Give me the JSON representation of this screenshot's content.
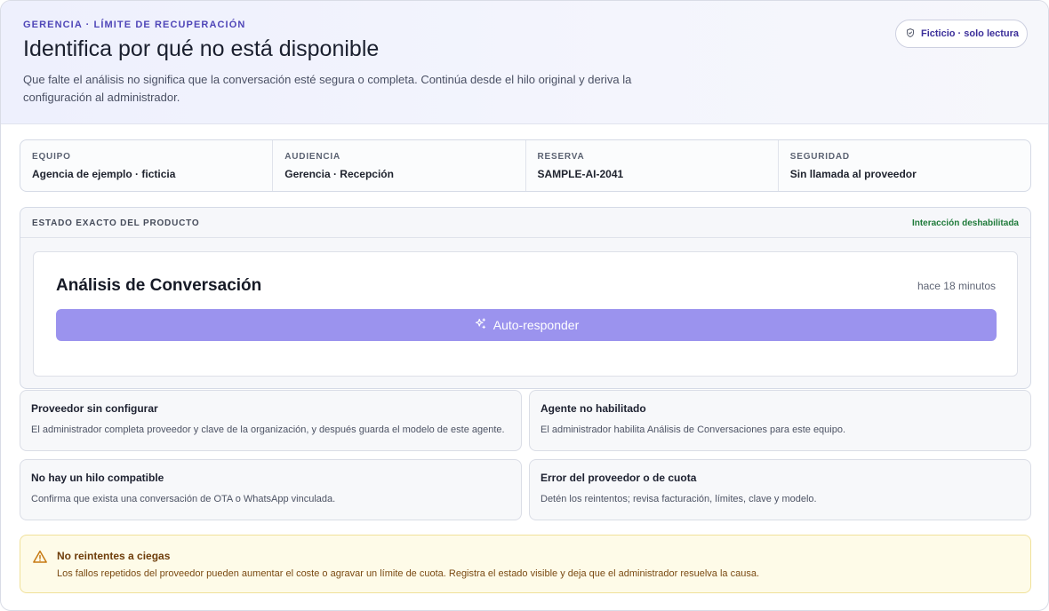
{
  "header": {
    "eyebrow": "GERENCIA · LÍMITE DE RECUPERACIÓN",
    "title": "Identifica por qué no está disponible",
    "description": "Que falte el análisis no significa que la conversación esté segura o completa. Continúa desde el hilo original y deriva la configuración al administrador.",
    "badge": {
      "icon": "shield-check-icon",
      "label": "Ficticio · solo lectura"
    }
  },
  "meta": [
    {
      "label": "EQUIPO",
      "value": "Agencia de ejemplo · ficticia"
    },
    {
      "label": "AUDIENCIA",
      "value": "Gerencia · Recepción"
    },
    {
      "label": "RESERVA",
      "value": "SAMPLE-AI-2041"
    },
    {
      "label": "SEGURIDAD",
      "value": "Sin llamada al proveedor"
    }
  ],
  "state": {
    "label": "ESTADO EXACTO DEL PRODUCTO",
    "status": "Interacción deshabilitada",
    "status_color": "#1f7a3a",
    "card": {
      "title": "Análisis de Conversación",
      "time": "hace 18 minutos",
      "button_icon": "sparkles-icon",
      "button_label": "Auto-responder",
      "button_color": "#9b93ee"
    }
  },
  "reasons": [
    {
      "title": "Proveedor sin configurar",
      "text": "El administrador completa proveedor y clave de la organización, y después guarda el modelo de este agente."
    },
    {
      "title": "Agente no habilitado",
      "text": "El administrador habilita Análisis de Conversaciones para este equipo."
    },
    {
      "title": "No hay un hilo compatible",
      "text": "Confirma que exista una conversación de OTA o WhatsApp vinculada."
    },
    {
      "title": "Error del proveedor o de cuota",
      "text": "Detén los reintentos; revisa facturación, límites, clave y modelo."
    }
  ],
  "warning": {
    "icon": "warning-triangle-icon",
    "title": "No reintentes a ciegas",
    "text": "Los fallos repetidos del proveedor pueden aumentar el coste o agravar un límite de cuota. Registra el estado visible y deja que el administrador resuelva la causa.",
    "accent": "#f0e19a"
  }
}
